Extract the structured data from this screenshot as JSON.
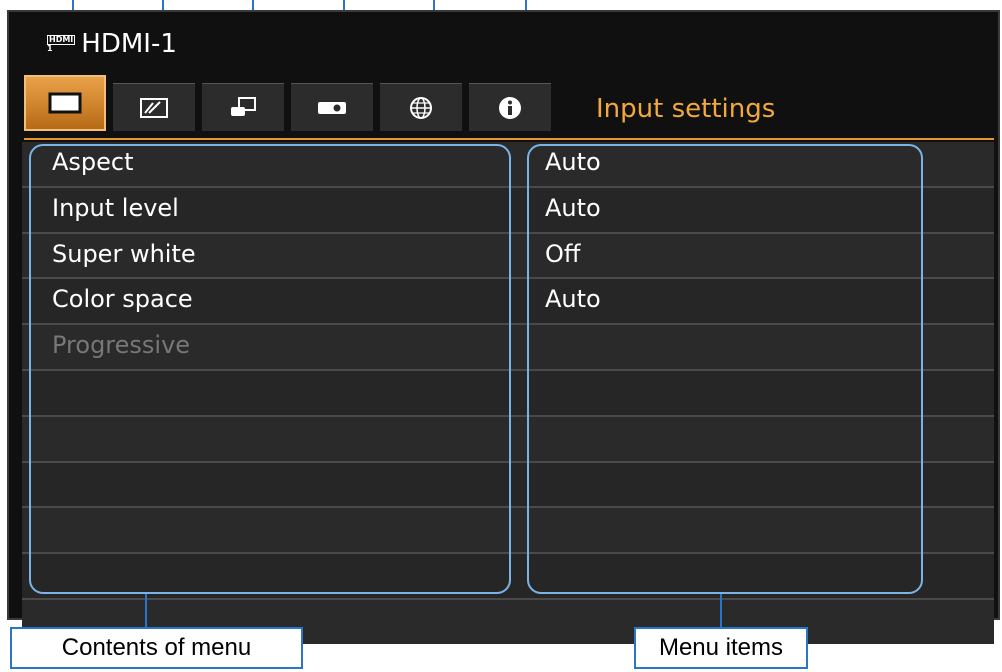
{
  "header": {
    "source_badge_top": "HDMI",
    "source_badge_bottom": "1",
    "source_label": "HDMI-1",
    "tab_title": "Input settings"
  },
  "tabs": [
    {
      "name": "input-settings",
      "icon": "screen-icon",
      "active": true
    },
    {
      "name": "image-adjustment",
      "icon": "image-adjust-icon",
      "active": false
    },
    {
      "name": "install-settings",
      "icon": "install-icon",
      "active": false
    },
    {
      "name": "system-settings",
      "icon": "projector-icon",
      "active": false
    },
    {
      "name": "network-settings",
      "icon": "globe-icon",
      "active": false
    },
    {
      "name": "information",
      "icon": "info-icon",
      "active": false
    }
  ],
  "menu": {
    "items": [
      {
        "label": "Aspect",
        "value": "Auto",
        "enabled": true
      },
      {
        "label": "Input level",
        "value": "Auto",
        "enabled": true
      },
      {
        "label": "Super white",
        "value": "Off",
        "enabled": true
      },
      {
        "label": "Color space",
        "value": "Auto",
        "enabled": true
      },
      {
        "label": "Progressive",
        "value": "",
        "enabled": false
      }
    ]
  },
  "annotations": {
    "contents_label": "Contents of menu",
    "items_label": "Menu items"
  },
  "colors": {
    "accent": "#e8962c",
    "callout": "#2a74c9"
  }
}
